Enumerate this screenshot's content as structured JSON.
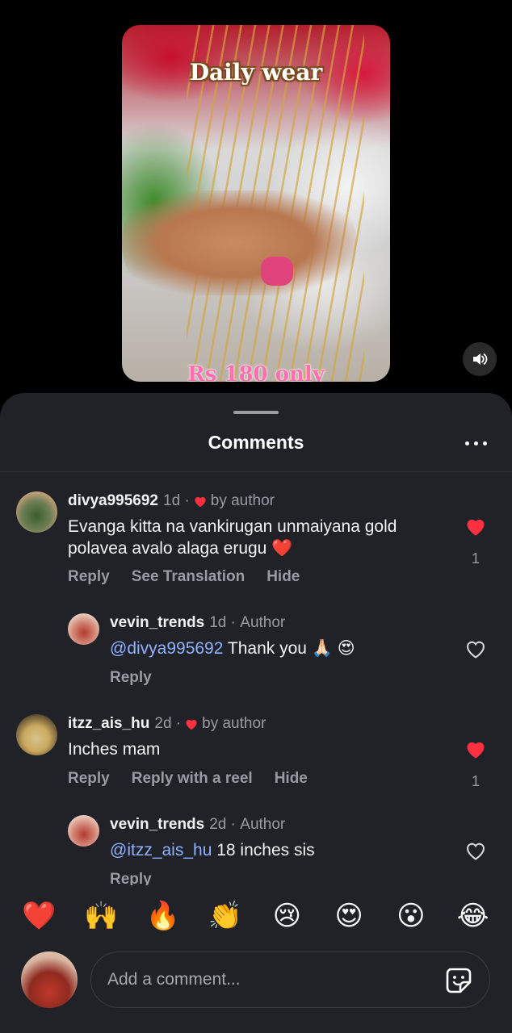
{
  "reel": {
    "title_overlay": "Daily wear",
    "price_overlay": "Rs 180 only",
    "volume_icon": "speaker-icon"
  },
  "sheet": {
    "title": "Comments",
    "more_icon": "more-horizontal-icon"
  },
  "comments": [
    {
      "username": "divya995692",
      "time": "1d",
      "badge": "by author",
      "text": "Evanga kitta na vankirugan unmaiyana gold polavea avalo alaga erugu ❤️",
      "actions": [
        "Reply",
        "See Translation",
        "Hide"
      ],
      "liked": true,
      "like_count": "1",
      "reply": {
        "username": "vevin_trends",
        "time": "1d",
        "badge": "Author",
        "mention": "@divya995692",
        "text": " Thank you 🙏🏻 😍",
        "actions": [
          "Reply"
        ],
        "liked": false
      }
    },
    {
      "username": "itzz_ais_hu",
      "time": "2d",
      "badge": "by author",
      "text": "Inches mam",
      "actions": [
        "Reply",
        "Reply with a reel",
        "Hide"
      ],
      "liked": true,
      "like_count": "1",
      "reply": {
        "username": "vevin_trends",
        "time": "2d",
        "badge": "Author",
        "mention": "@itzz_ais_hu",
        "text": " 18 inches sis",
        "actions": [
          "Reply"
        ],
        "liked": false
      }
    }
  ],
  "emoji_bar": [
    "❤️",
    "🙌",
    "🔥",
    "👏",
    "😢",
    "😍",
    "😮",
    "😂"
  ],
  "composer": {
    "placeholder": "Add a comment...",
    "sticker_icon": "sticker-icon"
  },
  "colors": {
    "sheet_bg": "#212228",
    "like_red": "#ff3040",
    "mention_blue": "#8fb2ff",
    "muted_text": "#9a9ba2"
  }
}
